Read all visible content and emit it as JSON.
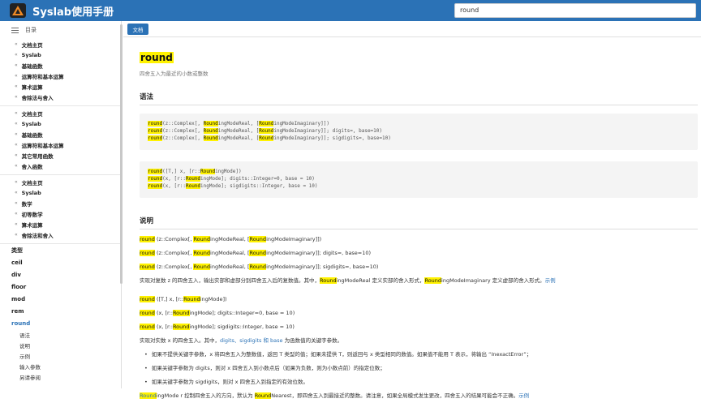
{
  "header": {
    "brand": "Syslab使用手册",
    "search_value": "round"
  },
  "sidebar": {
    "toc_label": "目录",
    "groups": [
      [
        "文档主页",
        "Syslab",
        "基础函数",
        "运算符和基本运算",
        "算术运算",
        "舍除法与舍入"
      ],
      [
        "文档主页",
        "Syslab",
        "基础函数",
        "运算符和基本运算",
        "其它常用函数",
        "舍入函数"
      ],
      [
        "文档主页",
        "Syslab",
        "数学",
        "初等数学",
        "算术运算",
        "舍除法和舍入"
      ]
    ],
    "functions": [
      "类型",
      "ceil",
      "div",
      "floor",
      "mod",
      "rem",
      "round"
    ],
    "subitems": [
      "语法",
      "说明",
      "示例",
      "输入参数",
      "另请参阅"
    ]
  },
  "toolbar": {
    "doc_button": "文档"
  },
  "page": {
    "title": "round",
    "subtitle": "四舍五入为最近的小数或整数",
    "syntax_heading": "语法",
    "desc_heading": "说明",
    "code1": [
      [
        "round",
        "(z::Complex[, ",
        "Round",
        "ingModeReal, [",
        "Round",
        "ingModeImaginary]])"
      ],
      [
        "round",
        "(z::Complex[, ",
        "Round",
        "ingModeReal, [",
        "Round",
        "ingModeImaginary]]; digits=, base=10)"
      ],
      [
        "round",
        "(z::Complex[, ",
        "Round",
        "ingModeReal, [",
        "Round",
        "ingModeImaginary]]; sigdigits=, base=10)"
      ]
    ],
    "code2": [
      [
        "round",
        "([T,] x, [r::",
        "Round",
        "ingMode])"
      ],
      [
        "round",
        "(x, [r::",
        "Round",
        "ingMode]; digits::Integer=0, base = 10)"
      ],
      [
        "round",
        "(x, [r::",
        "Round",
        "ingMode]; sigdigits::Integer, base = 10)"
      ]
    ],
    "desc1": [
      [
        "round",
        " (z::Complex[, ",
        "Round",
        "ingModeReal, [",
        "Round",
        "ingModeImaginary]])"
      ],
      [
        "round",
        " (z::Complex[, ",
        "Round",
        "ingModeReal, [",
        "Round",
        "ingModeImaginary]]; digits=, base=10)"
      ],
      [
        "round",
        " (z::Complex[, ",
        "Round",
        "ingModeReal, [",
        "Round",
        "ingModeImaginary]]; sigdigits=, base=10)"
      ]
    ],
    "desc1_text": {
      "a": "实现对复数 z 的四舍五入，输出实部和虚部分别四舍五入后的复数值。其中，",
      "h1": "Round",
      "b": "ingModeReal 定义实部的舍入形式，",
      "h2": "Round",
      "c": "ingModeImaginary 定义虚部的舍入形式。",
      "link": "示例"
    },
    "desc2": [
      [
        "round",
        " ([T,] x, [r::",
        "Round",
        "ingMode])"
      ],
      [
        "round",
        " (x, [r::",
        "Round",
        "ingMode]; digits::Integer=0, base = 10)"
      ],
      [
        "round",
        " (x, [r::",
        "Round",
        "ingMode]; sigdigits::Integer, base = 10)"
      ]
    ],
    "desc2_text": {
      "a": "实现对实数 x 的四舍五入。其中，",
      "link": "digits、sigdigits 和 base",
      "b": " 为函数值的关键字参数。"
    },
    "bullets": [
      "如果不提供关键字参数，x 将四舍五入为整数值，返回 T 类型的值；如果未提供 T，则返回与 x 类型相同的数值。如果值不能用 T 表示，将输出 “InexactError”；",
      "如果关键字参数为 digits，则对 x 四舍五入到小数点后（如果为负数，则为小数点前）的指定位数；",
      "如果关键字参数为 sigdigits，则对 x 四舍五入到指定的有效位数。"
    ],
    "last_line": {
      "h1": "Round",
      "a": "ingMode r 控制四舍五入的方向，默认为 ",
      "h2": "Round",
      "b": "Nearest，即四舍五入到最接近的整数。请注意，如果全局模式发生更改，四舍五入的结果可能会不正确。",
      "link": "示例"
    }
  }
}
